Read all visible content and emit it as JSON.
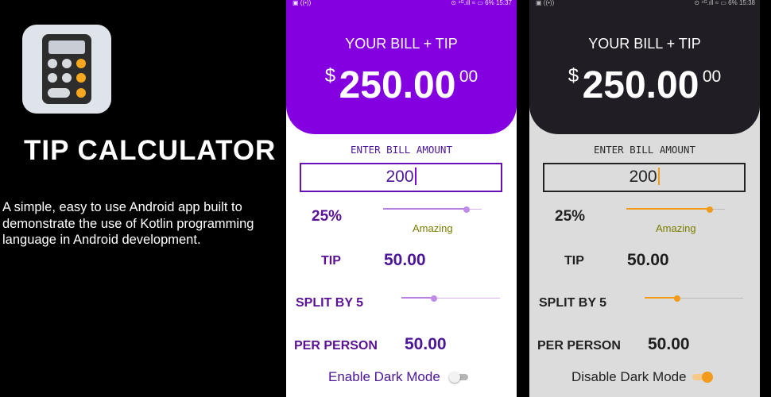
{
  "promo": {
    "title": "TIP CALCULATOR",
    "description": "A simple, easy to use Android app built to demonstrate the use of Kotlin programming language in Android development.",
    "icon": "calculator-icon"
  },
  "colors": {
    "light_accent": "#8400e0",
    "dark_header": "#201d24",
    "dark_accent": "#f29a19",
    "rating_text": "#7a7d00"
  },
  "light": {
    "status_left": "▣ ((•))",
    "status_right": "⊙ ⁴ᴳ.ıll ≈ ▭ 6% 15:37",
    "header_title": "YOUR BILL + TIP",
    "currency": "$",
    "total": "250.00",
    "cents": "00",
    "enter_label": "ENTER BILL AMOUNT",
    "bill_value": "200",
    "tip_percent": "25%",
    "tip_percent_value": 0.85,
    "tip_description": "Amazing",
    "tip_label": "TIP",
    "tip_amount": "50.00",
    "split_label": "SPLIT BY 5",
    "split_value": 0.33,
    "per_person_label": "PER PERSON",
    "per_person_amount": "50.00",
    "mode_label": "Enable Dark Mode",
    "mode_on": false
  },
  "dark": {
    "status_left": "▣ ((•))",
    "status_right": "⊙ ⁴ᴳ.ıll ≈ ▭ 6% 15:38",
    "header_title": "YOUR BILL + TIP",
    "currency": "$",
    "total": "250.00",
    "cents": "00",
    "enter_label": "ENTER BILL AMOUNT",
    "bill_value": "200",
    "tip_percent": "25%",
    "tip_percent_value": 0.85,
    "tip_description": "Amazing",
    "tip_label": "TIP",
    "tip_amount": "50.00",
    "split_label": "SPLIT BY 5",
    "split_value": 0.33,
    "per_person_label": "PER PERSON",
    "per_person_amount": "50.00",
    "mode_label": "Disable Dark Mode",
    "mode_on": true
  }
}
